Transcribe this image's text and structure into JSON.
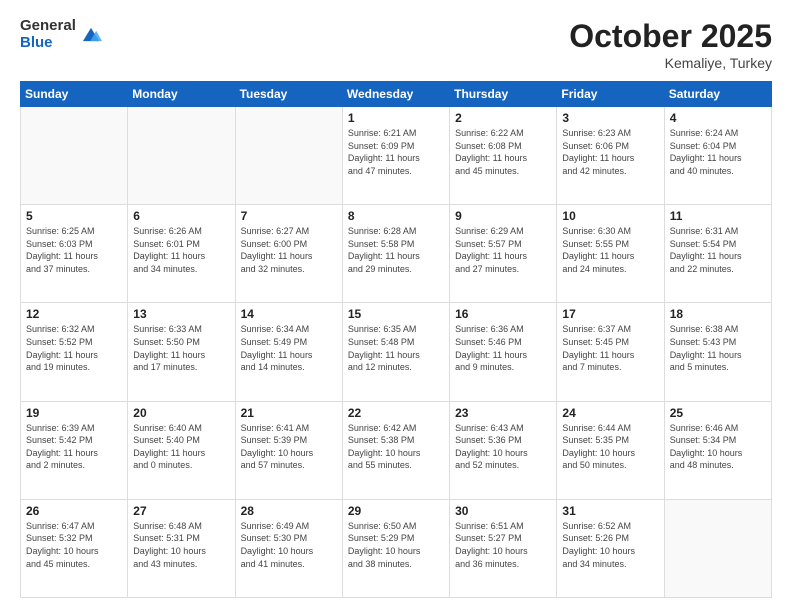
{
  "logo": {
    "general": "General",
    "blue": "Blue"
  },
  "title": "October 2025",
  "subtitle": "Kemaliye, Turkey",
  "headers": [
    "Sunday",
    "Monday",
    "Tuesday",
    "Wednesday",
    "Thursday",
    "Friday",
    "Saturday"
  ],
  "weeks": [
    [
      {
        "day": "",
        "info": ""
      },
      {
        "day": "",
        "info": ""
      },
      {
        "day": "",
        "info": ""
      },
      {
        "day": "1",
        "info": "Sunrise: 6:21 AM\nSunset: 6:09 PM\nDaylight: 11 hours\nand 47 minutes."
      },
      {
        "day": "2",
        "info": "Sunrise: 6:22 AM\nSunset: 6:08 PM\nDaylight: 11 hours\nand 45 minutes."
      },
      {
        "day": "3",
        "info": "Sunrise: 6:23 AM\nSunset: 6:06 PM\nDaylight: 11 hours\nand 42 minutes."
      },
      {
        "day": "4",
        "info": "Sunrise: 6:24 AM\nSunset: 6:04 PM\nDaylight: 11 hours\nand 40 minutes."
      }
    ],
    [
      {
        "day": "5",
        "info": "Sunrise: 6:25 AM\nSunset: 6:03 PM\nDaylight: 11 hours\nand 37 minutes."
      },
      {
        "day": "6",
        "info": "Sunrise: 6:26 AM\nSunset: 6:01 PM\nDaylight: 11 hours\nand 34 minutes."
      },
      {
        "day": "7",
        "info": "Sunrise: 6:27 AM\nSunset: 6:00 PM\nDaylight: 11 hours\nand 32 minutes."
      },
      {
        "day": "8",
        "info": "Sunrise: 6:28 AM\nSunset: 5:58 PM\nDaylight: 11 hours\nand 29 minutes."
      },
      {
        "day": "9",
        "info": "Sunrise: 6:29 AM\nSunset: 5:57 PM\nDaylight: 11 hours\nand 27 minutes."
      },
      {
        "day": "10",
        "info": "Sunrise: 6:30 AM\nSunset: 5:55 PM\nDaylight: 11 hours\nand 24 minutes."
      },
      {
        "day": "11",
        "info": "Sunrise: 6:31 AM\nSunset: 5:54 PM\nDaylight: 11 hours\nand 22 minutes."
      }
    ],
    [
      {
        "day": "12",
        "info": "Sunrise: 6:32 AM\nSunset: 5:52 PM\nDaylight: 11 hours\nand 19 minutes."
      },
      {
        "day": "13",
        "info": "Sunrise: 6:33 AM\nSunset: 5:50 PM\nDaylight: 11 hours\nand 17 minutes."
      },
      {
        "day": "14",
        "info": "Sunrise: 6:34 AM\nSunset: 5:49 PM\nDaylight: 11 hours\nand 14 minutes."
      },
      {
        "day": "15",
        "info": "Sunrise: 6:35 AM\nSunset: 5:48 PM\nDaylight: 11 hours\nand 12 minutes."
      },
      {
        "day": "16",
        "info": "Sunrise: 6:36 AM\nSunset: 5:46 PM\nDaylight: 11 hours\nand 9 minutes."
      },
      {
        "day": "17",
        "info": "Sunrise: 6:37 AM\nSunset: 5:45 PM\nDaylight: 11 hours\nand 7 minutes."
      },
      {
        "day": "18",
        "info": "Sunrise: 6:38 AM\nSunset: 5:43 PM\nDaylight: 11 hours\nand 5 minutes."
      }
    ],
    [
      {
        "day": "19",
        "info": "Sunrise: 6:39 AM\nSunset: 5:42 PM\nDaylight: 11 hours\nand 2 minutes."
      },
      {
        "day": "20",
        "info": "Sunrise: 6:40 AM\nSunset: 5:40 PM\nDaylight: 11 hours\nand 0 minutes."
      },
      {
        "day": "21",
        "info": "Sunrise: 6:41 AM\nSunset: 5:39 PM\nDaylight: 10 hours\nand 57 minutes."
      },
      {
        "day": "22",
        "info": "Sunrise: 6:42 AM\nSunset: 5:38 PM\nDaylight: 10 hours\nand 55 minutes."
      },
      {
        "day": "23",
        "info": "Sunrise: 6:43 AM\nSunset: 5:36 PM\nDaylight: 10 hours\nand 52 minutes."
      },
      {
        "day": "24",
        "info": "Sunrise: 6:44 AM\nSunset: 5:35 PM\nDaylight: 10 hours\nand 50 minutes."
      },
      {
        "day": "25",
        "info": "Sunrise: 6:46 AM\nSunset: 5:34 PM\nDaylight: 10 hours\nand 48 minutes."
      }
    ],
    [
      {
        "day": "26",
        "info": "Sunrise: 6:47 AM\nSunset: 5:32 PM\nDaylight: 10 hours\nand 45 minutes."
      },
      {
        "day": "27",
        "info": "Sunrise: 6:48 AM\nSunset: 5:31 PM\nDaylight: 10 hours\nand 43 minutes."
      },
      {
        "day": "28",
        "info": "Sunrise: 6:49 AM\nSunset: 5:30 PM\nDaylight: 10 hours\nand 41 minutes."
      },
      {
        "day": "29",
        "info": "Sunrise: 6:50 AM\nSunset: 5:29 PM\nDaylight: 10 hours\nand 38 minutes."
      },
      {
        "day": "30",
        "info": "Sunrise: 6:51 AM\nSunset: 5:27 PM\nDaylight: 10 hours\nand 36 minutes."
      },
      {
        "day": "31",
        "info": "Sunrise: 6:52 AM\nSunset: 5:26 PM\nDaylight: 10 hours\nand 34 minutes."
      },
      {
        "day": "",
        "info": ""
      }
    ]
  ]
}
